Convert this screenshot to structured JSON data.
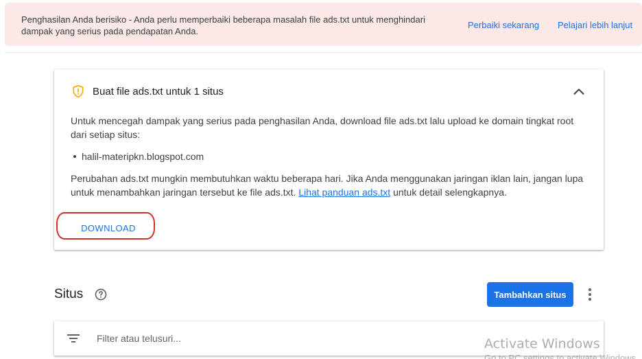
{
  "banner": {
    "message": "Penghasilan Anda berisiko - Anda perlu memperbaiki beberapa masalah file ads.txt untuk menghindari dampak yang serius pada pendapatan Anda.",
    "fix_label": "Perbaiki sekarang",
    "learn_label": "Pelajari lebih lanjut"
  },
  "card": {
    "icon": "shield-warning-icon",
    "title": "Buat file ads.txt untuk 1 situs",
    "intro": "Untuk mencegah dampak yang serius pada penghasilan Anda, download file ads.txt lalu upload ke domain tingkat root dari setiap situs:",
    "sites": [
      "halil-materipkn.blogspot.com"
    ],
    "note_before": "Perubahan ads.txt mungkin membutuhkan waktu beberapa hari. Jika Anda menggunakan jaringan iklan lain, jangan lupa untuk menambahkan jaringan tersebut ke file ads.txt. ",
    "note_link": "Lihat panduan ads.txt",
    "note_after": " untuk detail selengkapnya.",
    "download_label": "DOWNLOAD"
  },
  "sites_section": {
    "title": "Situs",
    "add_label": "Tambahkan situs",
    "filter_placeholder": "Filter atau telusuri..."
  },
  "watermark": {
    "title": "Activate Windows",
    "subtitle": "Go to PC settings to activate Windows."
  },
  "colors": {
    "accent": "#1a73e8",
    "banner_bg": "#fce8e6",
    "warning": "#f9ab00",
    "highlight_outline": "#d32f2f"
  }
}
